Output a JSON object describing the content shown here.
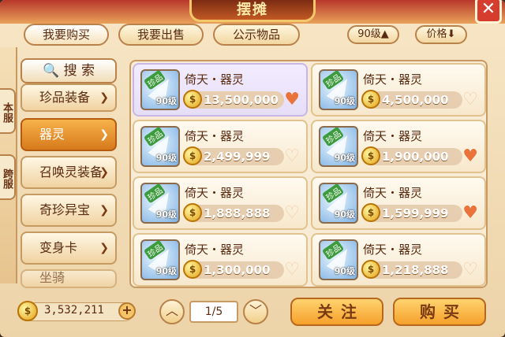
{
  "window": {
    "title": "摆摊",
    "close": "✕"
  },
  "tabs": [
    {
      "label": "我要购买"
    },
    {
      "label": "我要出售"
    },
    {
      "label": "公示物品"
    }
  ],
  "filters": {
    "level": "90级",
    "price": "价格"
  },
  "side_tabs": [
    "本服",
    "跨服"
  ],
  "search": {
    "label": "搜 索"
  },
  "categories": [
    {
      "label": "珍品装备"
    },
    {
      "label": "器灵"
    },
    {
      "label": "召唤灵装备"
    },
    {
      "label": "奇珍异宝"
    },
    {
      "label": "变身卡"
    },
    {
      "label": "坐骑"
    }
  ],
  "items": [
    {
      "name": "倚天・器灵",
      "badge": "珍品",
      "level": "90级",
      "price": "13,500,000",
      "followed": true
    },
    {
      "name": "倚天・器灵",
      "badge": "珍品",
      "level": "90级",
      "price": "4,500,000",
      "followed": false
    },
    {
      "name": "倚天・器灵",
      "badge": "珍品",
      "level": "90级",
      "price": "2,499,999",
      "followed": false
    },
    {
      "name": "倚天・器灵",
      "badge": "珍品",
      "level": "90级",
      "price": "1,900,000",
      "followed": true
    },
    {
      "name": "倚天・器灵",
      "badge": "珍品",
      "level": "90级",
      "price": "1,888,888",
      "followed": false
    },
    {
      "name": "倚天・器灵",
      "badge": "珍品",
      "level": "90级",
      "price": "1,599,999",
      "followed": true
    },
    {
      "name": "倚天・器灵",
      "badge": "珍品",
      "level": "90级",
      "price": "1,300,000",
      "followed": false
    },
    {
      "name": "倚天・器灵",
      "badge": "珍品",
      "level": "90级",
      "price": "1,218,888",
      "followed": false
    }
  ],
  "wallet": {
    "amount": "3,532,211",
    "plus": "+"
  },
  "pagination": {
    "current": "1/5"
  },
  "actions": {
    "follow": "关注",
    "buy": "购买"
  },
  "colors": {
    "accent": "#f5a02a",
    "selected_card": "#e6def7",
    "heart_filled": "#e9733b"
  }
}
